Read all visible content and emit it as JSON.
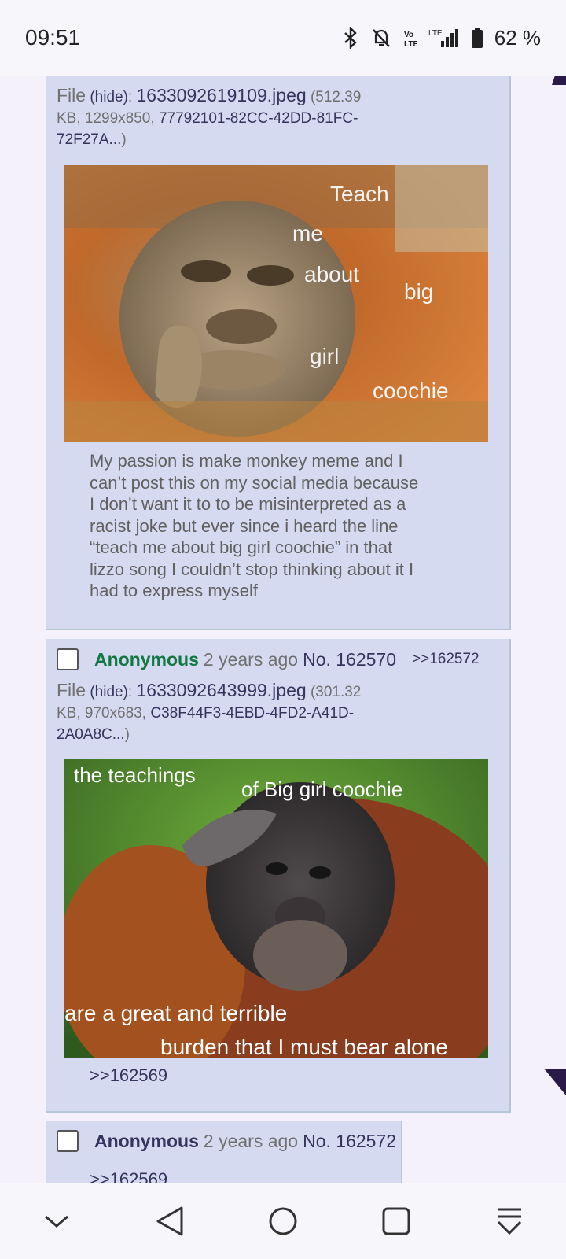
{
  "status_bar": {
    "time": "09:51",
    "battery_percent": "62 %",
    "network_label": "LTE",
    "icons": [
      "bluetooth-icon",
      "silent-bell-icon",
      "volte-icon",
      "lte-icon",
      "signal-icon",
      "battery-icon"
    ]
  },
  "posts": [
    {
      "file_label": "File",
      "hide_label": "(hide)",
      "filename": "1633092619109.jpeg",
      "file_meta_1": "(512.39",
      "file_meta_2": "KB, 1299x850,",
      "file_hash_1": "77792101-82CC-42DD-81FC-",
      "file_hash_2": "72F27A...",
      "file_close": ")",
      "image": {
        "overlay_words": [
          "Teach",
          "me",
          "about",
          "big",
          "girl",
          "coochie"
        ]
      },
      "comment_lines": [
        "My passion is make monkey meme and I",
        "can’t post this on my social media because",
        "I don’t want  it to to be misinterpreted as a",
        "racist joke but ever since i heard the line",
        "“teach me about big girl coochie” in that",
        "lizzo song I couldn’t stop thinking about it I",
        "had to express myself"
      ]
    },
    {
      "name": "Anonymous",
      "date": "2 years ago",
      "number": "No. 162570",
      "reply_link": ">>162572",
      "file_label": "File",
      "hide_label": "(hide)",
      "filename": "1633092643999.jpeg",
      "file_meta_1": "(301.32",
      "file_meta_2": "KB, 970x683,",
      "file_hash_1": "C38F44F3-4EBD-4FD2-A41D-",
      "file_hash_2": "2A0A8C...",
      "file_close": ")",
      "image": {
        "caption_top_1": "the teachings",
        "caption_top_2": "of Big girl coochie",
        "caption_bottom_1": "are a great and terrible",
        "caption_bottom_2": "burden that I must bear alone"
      },
      "quote": ">>162569"
    },
    {
      "name": "Anonymous",
      "date": "2 years ago",
      "number": "No. 162572",
      "quote": ">>162569"
    }
  ],
  "nav_bar": {
    "buttons": [
      "chevron-down-icon",
      "back-icon",
      "home-icon",
      "recents-icon",
      "scroll-bottom-icon"
    ]
  },
  "colors": {
    "post_bg": "#d6daf0",
    "name_green": "#117743",
    "link_blue": "#34345c",
    "accent_purple": "#2a1a4a"
  }
}
